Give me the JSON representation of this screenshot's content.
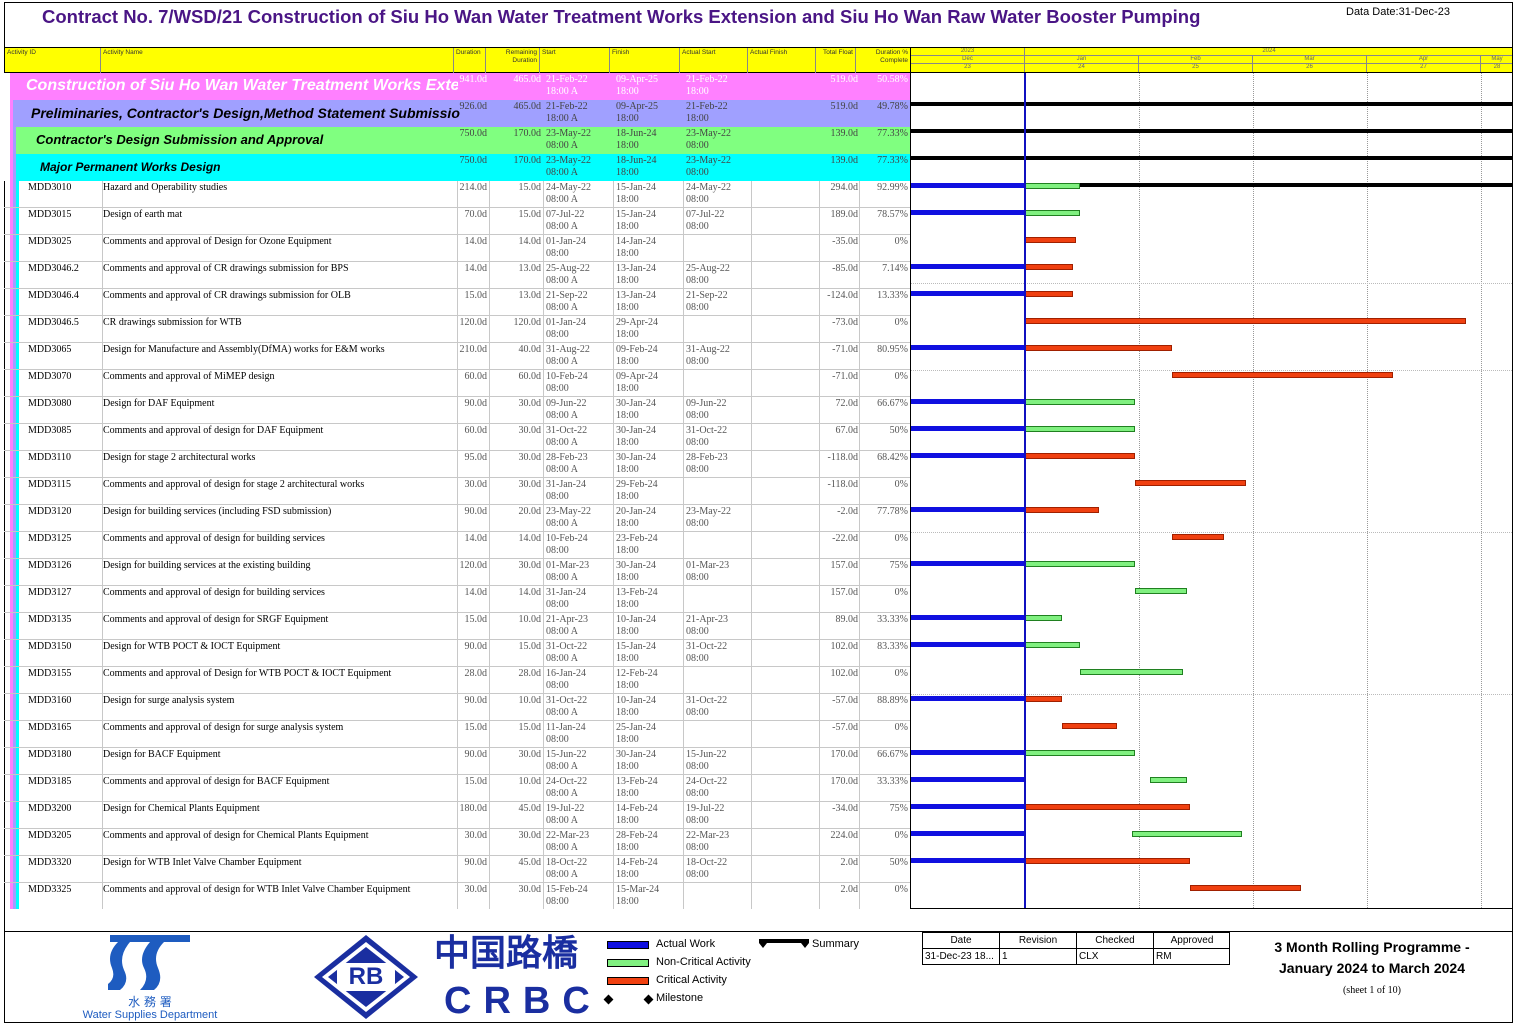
{
  "title": "Contract No. 7/WSD/21 Construction of Siu Ho Wan Water Treatment Works Extension and Siu Ho Wan Raw Water Booster Pumping",
  "data_date": "Data Date:31-Dec-23",
  "columns": {
    "id": "Activity ID",
    "name": "Activity Name",
    "od": "Duration",
    "rd": "Remaining Duration",
    "start": "Start",
    "finish": "Finish",
    "astart": "Actual Start",
    "afinish": "Actual Finish",
    "tf": "Total Float",
    "pct": "Duration % Complete"
  },
  "timescale": {
    "years": [
      "2023",
      "2024"
    ],
    "months": [
      "Dec",
      "Jan",
      "Feb",
      "Mar",
      "Apr",
      "May"
    ],
    "weeks": [
      "23",
      "24",
      "25",
      "26",
      "27",
      "28"
    ]
  },
  "groups": [
    {
      "name": "Construction of Siu Ho Wan Water Treatment Works Extension",
      "od": "941.0d",
      "rd": "465.0d",
      "start": "21-Feb-22",
      "start2": "18:00 A",
      "finish": "09-Apr-25",
      "finish2": "18:00",
      "astart": "21-Feb-22",
      "astart2": "18:00",
      "tf": "519.0d",
      "pct": "50.58%",
      "color": "#ff80ff",
      "text_color": "#ffffff",
      "level": 0,
      "summary": {
        "start": "2023-11-28",
        "end": "2024-05-31"
      }
    },
    {
      "name": "Preliminaries, Contractor's Design,Method Statement Submission",
      "od": "926.0d",
      "rd": "465.0d",
      "start": "21-Feb-22",
      "start2": "18:00 A",
      "finish": "09-Apr-25",
      "finish2": "18:00",
      "astart": "21-Feb-22",
      "astart2": "18:00",
      "tf": "519.0d",
      "pct": "49.78%",
      "color": "#a0a0ff",
      "text_color": "#000000",
      "level": 1,
      "summary": {
        "start": "2023-11-28",
        "end": "2024-05-31"
      }
    },
    {
      "name": "Contractor's Design Submission and Approval",
      "od": "750.0d",
      "rd": "170.0d",
      "start": "23-May-22",
      "start2": "08:00 A",
      "finish": "18-Jun-24",
      "finish2": "18:00",
      "astart": "23-May-22",
      "astart2": "08:00",
      "tf": "139.0d",
      "pct": "77.33%",
      "color": "#80ff80",
      "text_color": "#000000",
      "level": 2,
      "summary": {
        "start": "2023-11-28",
        "end": "2024-05-31"
      }
    },
    {
      "name": "Major Permanent Works Design",
      "od": "750.0d",
      "rd": "170.0d",
      "start": "23-May-22",
      "start2": "08:00 A",
      "finish": "18-Jun-24",
      "finish2": "18:00",
      "astart": "23-May-22",
      "astart2": "08:00",
      "tf": "139.0d",
      "pct": "77.33%",
      "color": "#00ffff",
      "text_color": "#000000",
      "level": 3,
      "summary": {
        "start": "2023-11-28",
        "end": "2024-05-31"
      }
    }
  ],
  "activities": [
    {
      "id": "MDD3010",
      "name": "Hazard and Operability studies",
      "od": "214.0d",
      "rd": "15.0d",
      "start": "24-May-22",
      "start2": "08:00 A",
      "finish": "15-Jan-24",
      "finish2": "18:00",
      "astart": "24-May-22",
      "astart2": "08:00",
      "tf": "294.0d",
      "pct": "92.99%",
      "actual": true,
      "bar_type": "noncritical",
      "bar_start": "2024-01-01",
      "bar_end": "2024-01-15"
    },
    {
      "id": "MDD3015",
      "name": "Design of earth mat",
      "od": "70.0d",
      "rd": "15.0d",
      "start": "07-Jul-22",
      "start2": "08:00 A",
      "finish": "15-Jan-24",
      "finish2": "18:00",
      "astart": "07-Jul-22",
      "astart2": "08:00",
      "tf": "189.0d",
      "pct": "78.57%",
      "actual": true,
      "bar_type": "noncritical",
      "bar_start": "2024-01-01",
      "bar_end": "2024-01-15"
    },
    {
      "id": "MDD3025",
      "name": "Comments and approval of Design for Ozone Equipment",
      "od": "14.0d",
      "rd": "14.0d",
      "start": "01-Jan-24",
      "start2": "08:00",
      "finish": "14-Jan-24",
      "finish2": "18:00",
      "astart": "",
      "astart2": "",
      "tf": "-35.0d",
      "pct": "0%",
      "actual": false,
      "bar_type": "critical",
      "bar_start": "2024-01-01",
      "bar_end": "2024-01-14"
    },
    {
      "id": "MDD3046.2",
      "name": "Comments and approval of CR drawings submission for BPS",
      "od": "14.0d",
      "rd": "13.0d",
      "start": "25-Aug-22",
      "start2": "08:00 A",
      "finish": "13-Jan-24",
      "finish2": "18:00",
      "astart": "25-Aug-22",
      "astart2": "08:00",
      "tf": "-85.0d",
      "pct": "7.14%",
      "actual": true,
      "bar_type": "critical",
      "bar_start": "2024-01-01",
      "bar_end": "2024-01-13"
    },
    {
      "id": "MDD3046.4",
      "name": "Comments and approval of CR drawings submission for OLB",
      "od": "15.0d",
      "rd": "13.0d",
      "start": "21-Sep-22",
      "start2": "08:00 A",
      "finish": "13-Jan-24",
      "finish2": "18:00",
      "astart": "21-Sep-22",
      "astart2": "08:00",
      "tf": "-124.0d",
      "pct": "13.33%",
      "actual": true,
      "bar_type": "critical",
      "bar_start": "2024-01-01",
      "bar_end": "2024-01-13"
    },
    {
      "id": "MDD3046.5",
      "name": "CR drawings submission for WTB",
      "od": "120.0d",
      "rd": "120.0d",
      "start": "01-Jan-24",
      "start2": "08:00",
      "finish": "29-Apr-24",
      "finish2": "18:00",
      "astart": "",
      "astart2": "",
      "tf": "-73.0d",
      "pct": "0%",
      "actual": false,
      "bar_type": "critical",
      "bar_start": "2024-01-01",
      "bar_end": "2024-04-29"
    },
    {
      "id": "MDD3065",
      "name": "Design for Manufacture and Assembly(DfMA) works for E&M works",
      "od": "210.0d",
      "rd": "40.0d",
      "start": "31-Aug-22",
      "start2": "08:00 A",
      "finish": "09-Feb-24",
      "finish2": "18:00",
      "astart": "31-Aug-22",
      "astart2": "08:00",
      "tf": "-71.0d",
      "pct": "80.95%",
      "actual": true,
      "bar_type": "critical",
      "bar_start": "2024-01-01",
      "bar_end": "2024-02-09"
    },
    {
      "id": "MDD3070",
      "name": "Comments and approval of MiMEP design",
      "od": "60.0d",
      "rd": "60.0d",
      "start": "10-Feb-24",
      "start2": "08:00",
      "finish": "09-Apr-24",
      "finish2": "18:00",
      "astart": "",
      "astart2": "",
      "tf": "-71.0d",
      "pct": "0%",
      "actual": false,
      "bar_type": "critical",
      "bar_start": "2024-02-10",
      "bar_end": "2024-04-09"
    },
    {
      "id": "MDD3080",
      "name": "Design for DAF Equipment",
      "od": "90.0d",
      "rd": "30.0d",
      "start": "09-Jun-22",
      "start2": "08:00 A",
      "finish": "30-Jan-24",
      "finish2": "18:00",
      "astart": "09-Jun-22",
      "astart2": "08:00",
      "tf": "72.0d",
      "pct": "66.67%",
      "actual": true,
      "bar_type": "noncritical",
      "bar_start": "2024-01-01",
      "bar_end": "2024-01-30"
    },
    {
      "id": "MDD3085",
      "name": "Comments and approval of design for DAF Equipment",
      "od": "60.0d",
      "rd": "30.0d",
      "start": "31-Oct-22",
      "start2": "08:00 A",
      "finish": "30-Jan-24",
      "finish2": "18:00",
      "astart": "31-Oct-22",
      "astart2": "08:00",
      "tf": "67.0d",
      "pct": "50%",
      "actual": true,
      "bar_type": "noncritical",
      "bar_start": "2024-01-01",
      "bar_end": "2024-01-30"
    },
    {
      "id": "MDD3110",
      "name": "Design for stage 2 architectural works",
      "od": "95.0d",
      "rd": "30.0d",
      "start": "28-Feb-23",
      "start2": "08:00 A",
      "finish": "30-Jan-24",
      "finish2": "18:00",
      "astart": "28-Feb-23",
      "astart2": "08:00",
      "tf": "-118.0d",
      "pct": "68.42%",
      "actual": true,
      "bar_type": "critical",
      "bar_start": "2024-01-01",
      "bar_end": "2024-01-30"
    },
    {
      "id": "MDD3115",
      "name": "Comments and approval of design for stage 2 architectural works",
      "od": "30.0d",
      "rd": "30.0d",
      "start": "31-Jan-24",
      "start2": "08:00",
      "finish": "29-Feb-24",
      "finish2": "18:00",
      "astart": "",
      "astart2": "",
      "tf": "-118.0d",
      "pct": "0%",
      "actual": false,
      "bar_type": "critical",
      "bar_start": "2024-01-31",
      "bar_end": "2024-02-29"
    },
    {
      "id": "MDD3120",
      "name": "Design for building services (including FSD submission)",
      "od": "90.0d",
      "rd": "20.0d",
      "start": "23-May-22",
      "start2": "08:00 A",
      "finish": "20-Jan-24",
      "finish2": "18:00",
      "astart": "23-May-22",
      "astart2": "08:00",
      "tf": "-2.0d",
      "pct": "77.78%",
      "actual": true,
      "bar_type": "critical",
      "bar_start": "2024-01-01",
      "bar_end": "2024-01-20"
    },
    {
      "id": "MDD3125",
      "name": "Comments and approval of design for building services",
      "od": "14.0d",
      "rd": "14.0d",
      "start": "10-Feb-24",
      "start2": "08:00",
      "finish": "23-Feb-24",
      "finish2": "18:00",
      "astart": "",
      "astart2": "",
      "tf": "-22.0d",
      "pct": "0%",
      "actual": false,
      "bar_type": "critical",
      "bar_start": "2024-02-10",
      "bar_end": "2024-02-23"
    },
    {
      "id": "MDD3126",
      "name": "Design for building services at the existing building",
      "od": "120.0d",
      "rd": "30.0d",
      "start": "01-Mar-23",
      "start2": "08:00 A",
      "finish": "30-Jan-24",
      "finish2": "18:00",
      "astart": "01-Mar-23",
      "astart2": "08:00",
      "tf": "157.0d",
      "pct": "75%",
      "actual": true,
      "bar_type": "noncritical",
      "bar_start": "2024-01-01",
      "bar_end": "2024-01-30"
    },
    {
      "id": "MDD3127",
      "name": "Comments and approval of design for building services",
      "od": "14.0d",
      "rd": "14.0d",
      "start": "31-Jan-24",
      "start2": "08:00",
      "finish": "13-Feb-24",
      "finish2": "18:00",
      "astart": "",
      "astart2": "",
      "tf": "157.0d",
      "pct": "0%",
      "actual": false,
      "bar_type": "noncritical",
      "bar_start": "2024-01-31",
      "bar_end": "2024-02-13"
    },
    {
      "id": "MDD3135",
      "name": "Comments and approval of design for SRGF Equipment",
      "od": "15.0d",
      "rd": "10.0d",
      "start": "21-Apr-23",
      "start2": "08:00 A",
      "finish": "10-Jan-24",
      "finish2": "18:00",
      "astart": "21-Apr-23",
      "astart2": "08:00",
      "tf": "89.0d",
      "pct": "33.33%",
      "actual": true,
      "bar_type": "noncritical",
      "bar_start": "2024-01-01",
      "bar_end": "2024-01-10"
    },
    {
      "id": "MDD3150",
      "name": "Design for WTB POCT & IOCT Equipment",
      "od": "90.0d",
      "rd": "15.0d",
      "start": "31-Oct-22",
      "start2": "08:00 A",
      "finish": "15-Jan-24",
      "finish2": "18:00",
      "astart": "31-Oct-22",
      "astart2": "08:00",
      "tf": "102.0d",
      "pct": "83.33%",
      "actual": true,
      "bar_type": "noncritical",
      "bar_start": "2024-01-01",
      "bar_end": "2024-01-15"
    },
    {
      "id": "MDD3155",
      "name": "Comments and approval of Design for WTB POCT & IOCT Equipment",
      "od": "28.0d",
      "rd": "28.0d",
      "start": "16-Jan-24",
      "start2": "08:00",
      "finish": "12-Feb-24",
      "finish2": "18:00",
      "astart": "",
      "astart2": "",
      "tf": "102.0d",
      "pct": "0%",
      "actual": false,
      "bar_type": "noncritical",
      "bar_start": "2024-01-16",
      "bar_end": "2024-02-12"
    },
    {
      "id": "MDD3160",
      "name": "Design for surge analysis system",
      "od": "90.0d",
      "rd": "10.0d",
      "start": "31-Oct-22",
      "start2": "08:00 A",
      "finish": "10-Jan-24",
      "finish2": "18:00",
      "astart": "31-Oct-22",
      "astart2": "08:00",
      "tf": "-57.0d",
      "pct": "88.89%",
      "actual": true,
      "bar_type": "critical",
      "bar_start": "2024-01-01",
      "bar_end": "2024-01-10"
    },
    {
      "id": "MDD3165",
      "name": "Comments and approval of design for surge analysis system",
      "od": "15.0d",
      "rd": "15.0d",
      "start": "11-Jan-24",
      "start2": "08:00",
      "finish": "25-Jan-24",
      "finish2": "18:00",
      "astart": "",
      "astart2": "",
      "tf": "-57.0d",
      "pct": "0%",
      "actual": false,
      "bar_type": "critical",
      "bar_start": "2024-01-11",
      "bar_end": "2024-01-25"
    },
    {
      "id": "MDD3180",
      "name": "Design for BACF Equipment",
      "od": "90.0d",
      "rd": "30.0d",
      "start": "15-Jun-22",
      "start2": "08:00 A",
      "finish": "30-Jan-24",
      "finish2": "18:00",
      "astart": "15-Jun-22",
      "astart2": "08:00",
      "tf": "170.0d",
      "pct": "66.67%",
      "actual": true,
      "bar_type": "noncritical",
      "bar_start": "2024-01-01",
      "bar_end": "2024-01-30"
    },
    {
      "id": "MDD3185",
      "name": "Comments and approval of design for BACF Equipment",
      "od": "15.0d",
      "rd": "10.0d",
      "start": "24-Oct-22",
      "start2": "08:00 A",
      "finish": "13-Feb-24",
      "finish2": "18:00",
      "astart": "24-Oct-22",
      "astart2": "08:00",
      "tf": "170.0d",
      "pct": "33.33%",
      "actual": true,
      "bar_type": "noncritical",
      "bar_start": "2024-02-04",
      "bar_end": "2024-02-13"
    },
    {
      "id": "MDD3200",
      "name": "Design for Chemical Plants Equipment",
      "od": "180.0d",
      "rd": "45.0d",
      "start": "19-Jul-22",
      "start2": "08:00 A",
      "finish": "14-Feb-24",
      "finish2": "18:00",
      "astart": "19-Jul-22",
      "astart2": "08:00",
      "tf": "-34.0d",
      "pct": "75%",
      "actual": true,
      "bar_type": "critical",
      "bar_start": "2024-01-01",
      "bar_end": "2024-02-14"
    },
    {
      "id": "MDD3205",
      "name": "Comments and approval of design for Chemical Plants Equipment",
      "od": "30.0d",
      "rd": "30.0d",
      "start": "22-Mar-23",
      "start2": "08:00 A",
      "finish": "28-Feb-24",
      "finish2": "18:00",
      "astart": "22-Mar-23",
      "astart2": "08:00",
      "tf": "224.0d",
      "pct": "0%",
      "actual": true,
      "bar_type": "noncritical",
      "bar_start": "2024-01-30",
      "bar_end": "2024-02-28"
    },
    {
      "id": "MDD3320",
      "name": "Design for WTB Inlet Valve Chamber Equipment",
      "od": "90.0d",
      "rd": "45.0d",
      "start": "18-Oct-22",
      "start2": "08:00 A",
      "finish": "14-Feb-24",
      "finish2": "18:00",
      "astart": "18-Oct-22",
      "astart2": "08:00",
      "tf": "2.0d",
      "pct": "50%",
      "actual": true,
      "bar_type": "critical",
      "bar_start": "2024-01-01",
      "bar_end": "2024-02-14"
    },
    {
      "id": "MDD3325",
      "name": "Comments and approval of design for WTB Inlet Valve Chamber Equipment",
      "od": "30.0d",
      "rd": "30.0d",
      "start": "15-Feb-24",
      "start2": "08:00",
      "finish": "15-Mar-24",
      "finish2": "18:00",
      "astart": "",
      "astart2": "",
      "tf": "2.0d",
      "pct": "0%",
      "actual": false,
      "bar_type": "critical",
      "bar_start": "2024-02-15",
      "bar_end": "2024-03-15"
    }
  ],
  "legend": {
    "actual": "Actual Work",
    "noncritical": "Non-Critical Activity",
    "critical": "Critical Activity",
    "milestone": "Milestone",
    "summary": "Summary"
  },
  "colors": {
    "actual": "#1010e0",
    "noncritical": "#80f080",
    "critical": "#f04010",
    "dataline": "#1010c0",
    "title": "#4a1585",
    "header": "#ffff00"
  },
  "logos": {
    "wsd_chinese": "水 務 署",
    "wsd_english": "Water Supplies Department",
    "rb": "RB",
    "crbc_chinese": "中国路橋",
    "crbc_english": "CRBC"
  },
  "approval": {
    "headers": [
      "Date",
      "Revision",
      "Checked",
      "Approved"
    ],
    "values": [
      "31-Dec-23 18...",
      "1",
      "CLX",
      "RM"
    ]
  },
  "programme": {
    "line1": "3 Month Rolling Programme -",
    "line2": "January 2024 to March 2024",
    "sheet": "(sheet 1 of 10)"
  }
}
